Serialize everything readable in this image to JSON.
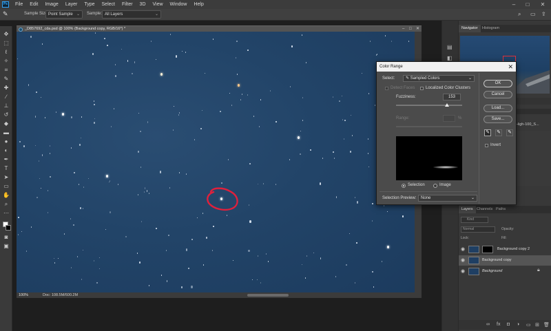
{
  "menubar": {
    "items": [
      "File",
      "Edit",
      "Image",
      "Layer",
      "Type",
      "Select",
      "Filter",
      "3D",
      "View",
      "Window",
      "Help"
    ],
    "logo": "Ps"
  },
  "options": {
    "sample_size_label": "Sample Size:",
    "sample_size_value": "Point Sample",
    "sample_label": "Sample:",
    "sample_value": "All Layers"
  },
  "document": {
    "tab_title": "_D857692_cda.psd @ 100% (Background copy, RGB/16*) *",
    "zoom": "100%",
    "doc_size": "Doc: 108.5M/600.2M"
  },
  "navigator": {
    "tabs": [
      "Navigator",
      "Histogram"
    ]
  },
  "panel_mid": {
    "label": "_High-100_S..."
  },
  "layers": {
    "tabs": [
      "Layers",
      "Channels",
      "Paths"
    ],
    "search_placeholder": "Kind",
    "blend_mode": "Normal",
    "opacity_label": "Opacity:",
    "lock_label": "Lock:",
    "fill_label": "Fill:",
    "items": [
      {
        "name": "Background copy 2",
        "has_mask": true
      },
      {
        "name": "Background copy",
        "has_mask": false,
        "selected": true
      },
      {
        "name": "Background",
        "has_mask": false,
        "italic": true,
        "locked": true
      }
    ]
  },
  "dialog": {
    "title": "Color Range",
    "select_label": "Select:",
    "select_value": "Sampled Colors",
    "detect_faces": "Detect Faces",
    "localized_clusters": "Localized Color Clusters",
    "fuzziness_label": "Fuzziness:",
    "fuzziness_value": "153",
    "fuzziness_fraction": 0.77,
    "range_label": "Range:",
    "range_unit": "%",
    "radio_selection": "Selection",
    "radio_image": "Image",
    "preview_label": "Selection Preview:",
    "preview_value": "None",
    "buttons": {
      "ok": "OK",
      "cancel": "Cancel",
      "load": "Load...",
      "save": "Save..."
    },
    "invert_label": "Invert"
  },
  "colors": {
    "annotation_circle": "#e0203c",
    "sky": "#224468",
    "accent": "#31a8ff"
  }
}
